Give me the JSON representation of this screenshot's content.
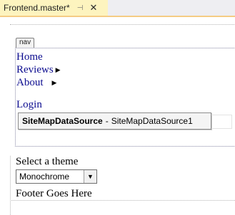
{
  "tab": {
    "title": "Frontend.master*",
    "pin_glyph": "⊣",
    "close_glyph": "✕"
  },
  "nav": {
    "tag_label": "nav",
    "menu": [
      {
        "label": "Home",
        "has_submenu": false
      },
      {
        "label": "Reviews",
        "has_submenu": true
      },
      {
        "label": "About",
        "has_submenu": true
      }
    ],
    "login_label": "Login"
  },
  "sitemap": {
    "type": "SiteMapDataSource",
    "separator": "-",
    "id": "SiteMapDataSource1"
  },
  "theme": {
    "label": "Select a theme",
    "selected": "Monochrome"
  },
  "footer": {
    "text": "Footer Goes Here"
  },
  "colors": {
    "tab_active": "#fdf4bf",
    "tab_accent": "#f5cc84",
    "link": "#0b0b8f"
  }
}
